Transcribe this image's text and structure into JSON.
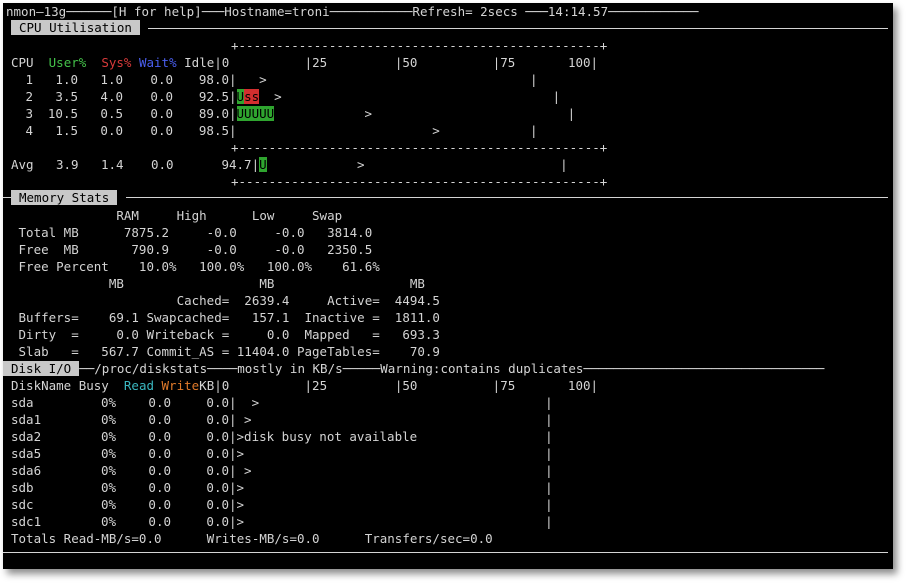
{
  "titlebar": {
    "app": "nmon—13g",
    "help": "[H for help]",
    "hostname": "Hostname=troni",
    "refresh": "Refresh= 2secs",
    "time": "14:14.57"
  },
  "cpu": {
    "title": "CPU Utilisation",
    "scale_line": "+------------------------------------------------+",
    "scale_labels": "|0          |25         |50          |75       100|",
    "headers": {
      "cpu": "CPU",
      "user": "User%",
      "sys": "Sys%",
      "wait": "Wait%",
      "idle": "Idle"
    },
    "rows": [
      {
        "id": "1",
        "user": "1.0",
        "sys": "1.0",
        "wait": "0.0",
        "idle": "98.0",
        "bar_user": "",
        "bar_sys": "",
        "tail": "   >                                   |"
      },
      {
        "id": "2",
        "user": "3.5",
        "sys": "4.0",
        "wait": "0.0",
        "idle": "92.5",
        "bar_user": "U",
        "bar_sys": "ss",
        "tail": "  >                                    |"
      },
      {
        "id": "3",
        "user": "10.5",
        "sys": "0.5",
        "wait": "0.0",
        "idle": "89.0",
        "bar_user": "UUUUU",
        "bar_sys": "",
        "tail": "            >                          |"
      },
      {
        "id": "4",
        "user": "1.5",
        "sys": "0.0",
        "wait": "0.0",
        "idle": "98.5",
        "bar_user": "",
        "bar_sys": "",
        "tail": "                          >            |"
      }
    ],
    "avg": {
      "label": "Avg",
      "user": "3.9",
      "sys": "1.4",
      "wait": "0.0",
      "idle": "94.7",
      "bar_user": "U",
      "tail": "            >                          |"
    }
  },
  "memory": {
    "title": "Memory Stats",
    "header": "              RAM     High      Low     Swap",
    "lines": [
      " Total MB      7875.2     -0.0     -0.0   3814.0",
      " Free  MB       790.9     -0.0     -0.0   2350.5",
      " Free Percent    10.0%   100.0%   100.0%    61.6%",
      "             MB                  MB                  MB",
      "                      Cached=  2639.4     Active=  4494.5",
      " Buffers=    69.1 Swapcached=   157.1  Inactive =  1811.0",
      " Dirty  =     0.0 Writeback =     0.0  Mapped   =   693.3",
      " Slab   =   567.7 Commit_AS = 11404.0 PageTables=    70.9"
    ]
  },
  "disk": {
    "title": "Disk I/O",
    "subtitle": "──/proc/diskstats────mostly in KB/s─────Warning:contains duplicates──",
    "header_name": "DiskName Busy  ",
    "header_read": "Read ",
    "header_write": "Write",
    "header_rest": "KB|0          |25         |50          |75       100|",
    "rows": [
      {
        "name": "sda",
        "busy": "0%",
        "read": "0.0",
        "write": "0.0",
        "tail": "|  >                                      |"
      },
      {
        "name": "sda1",
        "busy": "0%",
        "read": "0.0",
        "write": "0.0",
        "tail": "| >                                       |"
      },
      {
        "name": "sda2",
        "busy": "0%",
        "read": "0.0",
        "write": "0.0",
        "tail": "|>disk busy not available                 |"
      },
      {
        "name": "sda5",
        "busy": "0%",
        "read": "0.0",
        "write": "0.0",
        "tail": "|>                                        |"
      },
      {
        "name": "sda6",
        "busy": "0%",
        "read": "0.0",
        "write": "0.0",
        "tail": "| >                                       |"
      },
      {
        "name": "sdb",
        "busy": "0%",
        "read": "0.0",
        "write": "0.0",
        "tail": "|>                                        |"
      },
      {
        "name": "sdc",
        "busy": "0%",
        "read": "0.0",
        "write": "0.0",
        "tail": "|>                                        |"
      },
      {
        "name": "sdc1",
        "busy": "0%",
        "read": "0.0",
        "write": "0.0",
        "tail": "|>                                        |"
      }
    ],
    "totals": "Totals Read-MB/s=0.0      Writes-MB/s=0.0      Transfers/sec=0.0"
  }
}
